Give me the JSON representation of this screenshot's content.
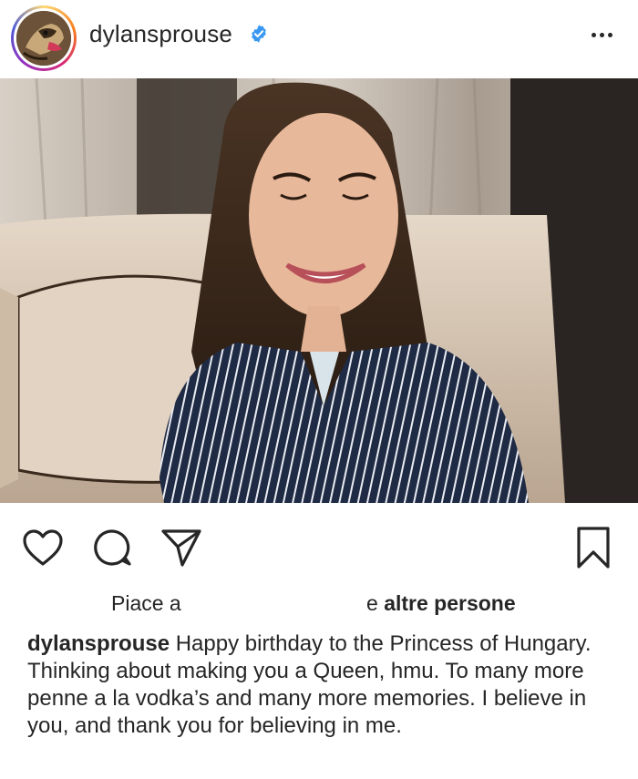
{
  "post": {
    "username": "dylansprouse",
    "verified": true,
    "accent_color": "#3897f0"
  },
  "icons": {
    "more": "more-horizontal-icon",
    "like": "heart-icon",
    "comment": "comment-icon",
    "share": "send-icon",
    "save": "bookmark-icon"
  },
  "likes": {
    "prefix": "Piace a",
    "suffix_pre": "e",
    "suffix_bold": "altre persone"
  },
  "caption": {
    "username": "dylansprouse",
    "text": "Happy birthday to the Princess of Hungary. Thinking about making you a Queen, hmu. To many more penne a la vodka’s and many more memories. I believe in you, and thank you for believing in me."
  }
}
